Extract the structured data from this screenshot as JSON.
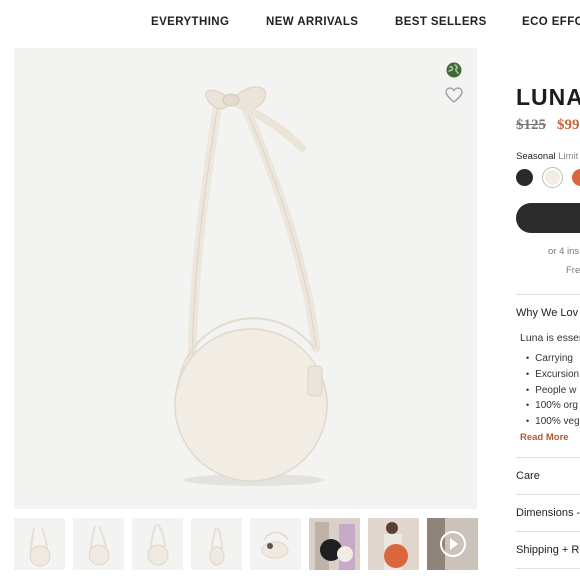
{
  "nav": {
    "items": [
      "EVERYTHING",
      "NEW ARRIVALS",
      "BEST SELLERS",
      "ECO EFFOR"
    ]
  },
  "product": {
    "title": "LUNA",
    "price_original": "$125",
    "price_sale": "$99",
    "color_label": "Seasonal",
    "color_note": "Limit",
    "swatches": [
      "#2a2a2a",
      "#f1ece4",
      "#d9663c"
    ],
    "installments_text": "or 4 ins",
    "shipping_text": "Fre"
  },
  "details": {
    "why_title": "Why We Lov",
    "description": "Luna is essen",
    "bullets": [
      "Carrying",
      "Excursion",
      "People w",
      "100% org",
      "100% veg"
    ],
    "read_more": "Read More",
    "care_title": "Care",
    "dimensions_title": "Dimensions -",
    "shipping_title": "Shipping + R"
  },
  "gallery": {
    "thumbnail_count": 8,
    "active_thumbnail": 1
  }
}
